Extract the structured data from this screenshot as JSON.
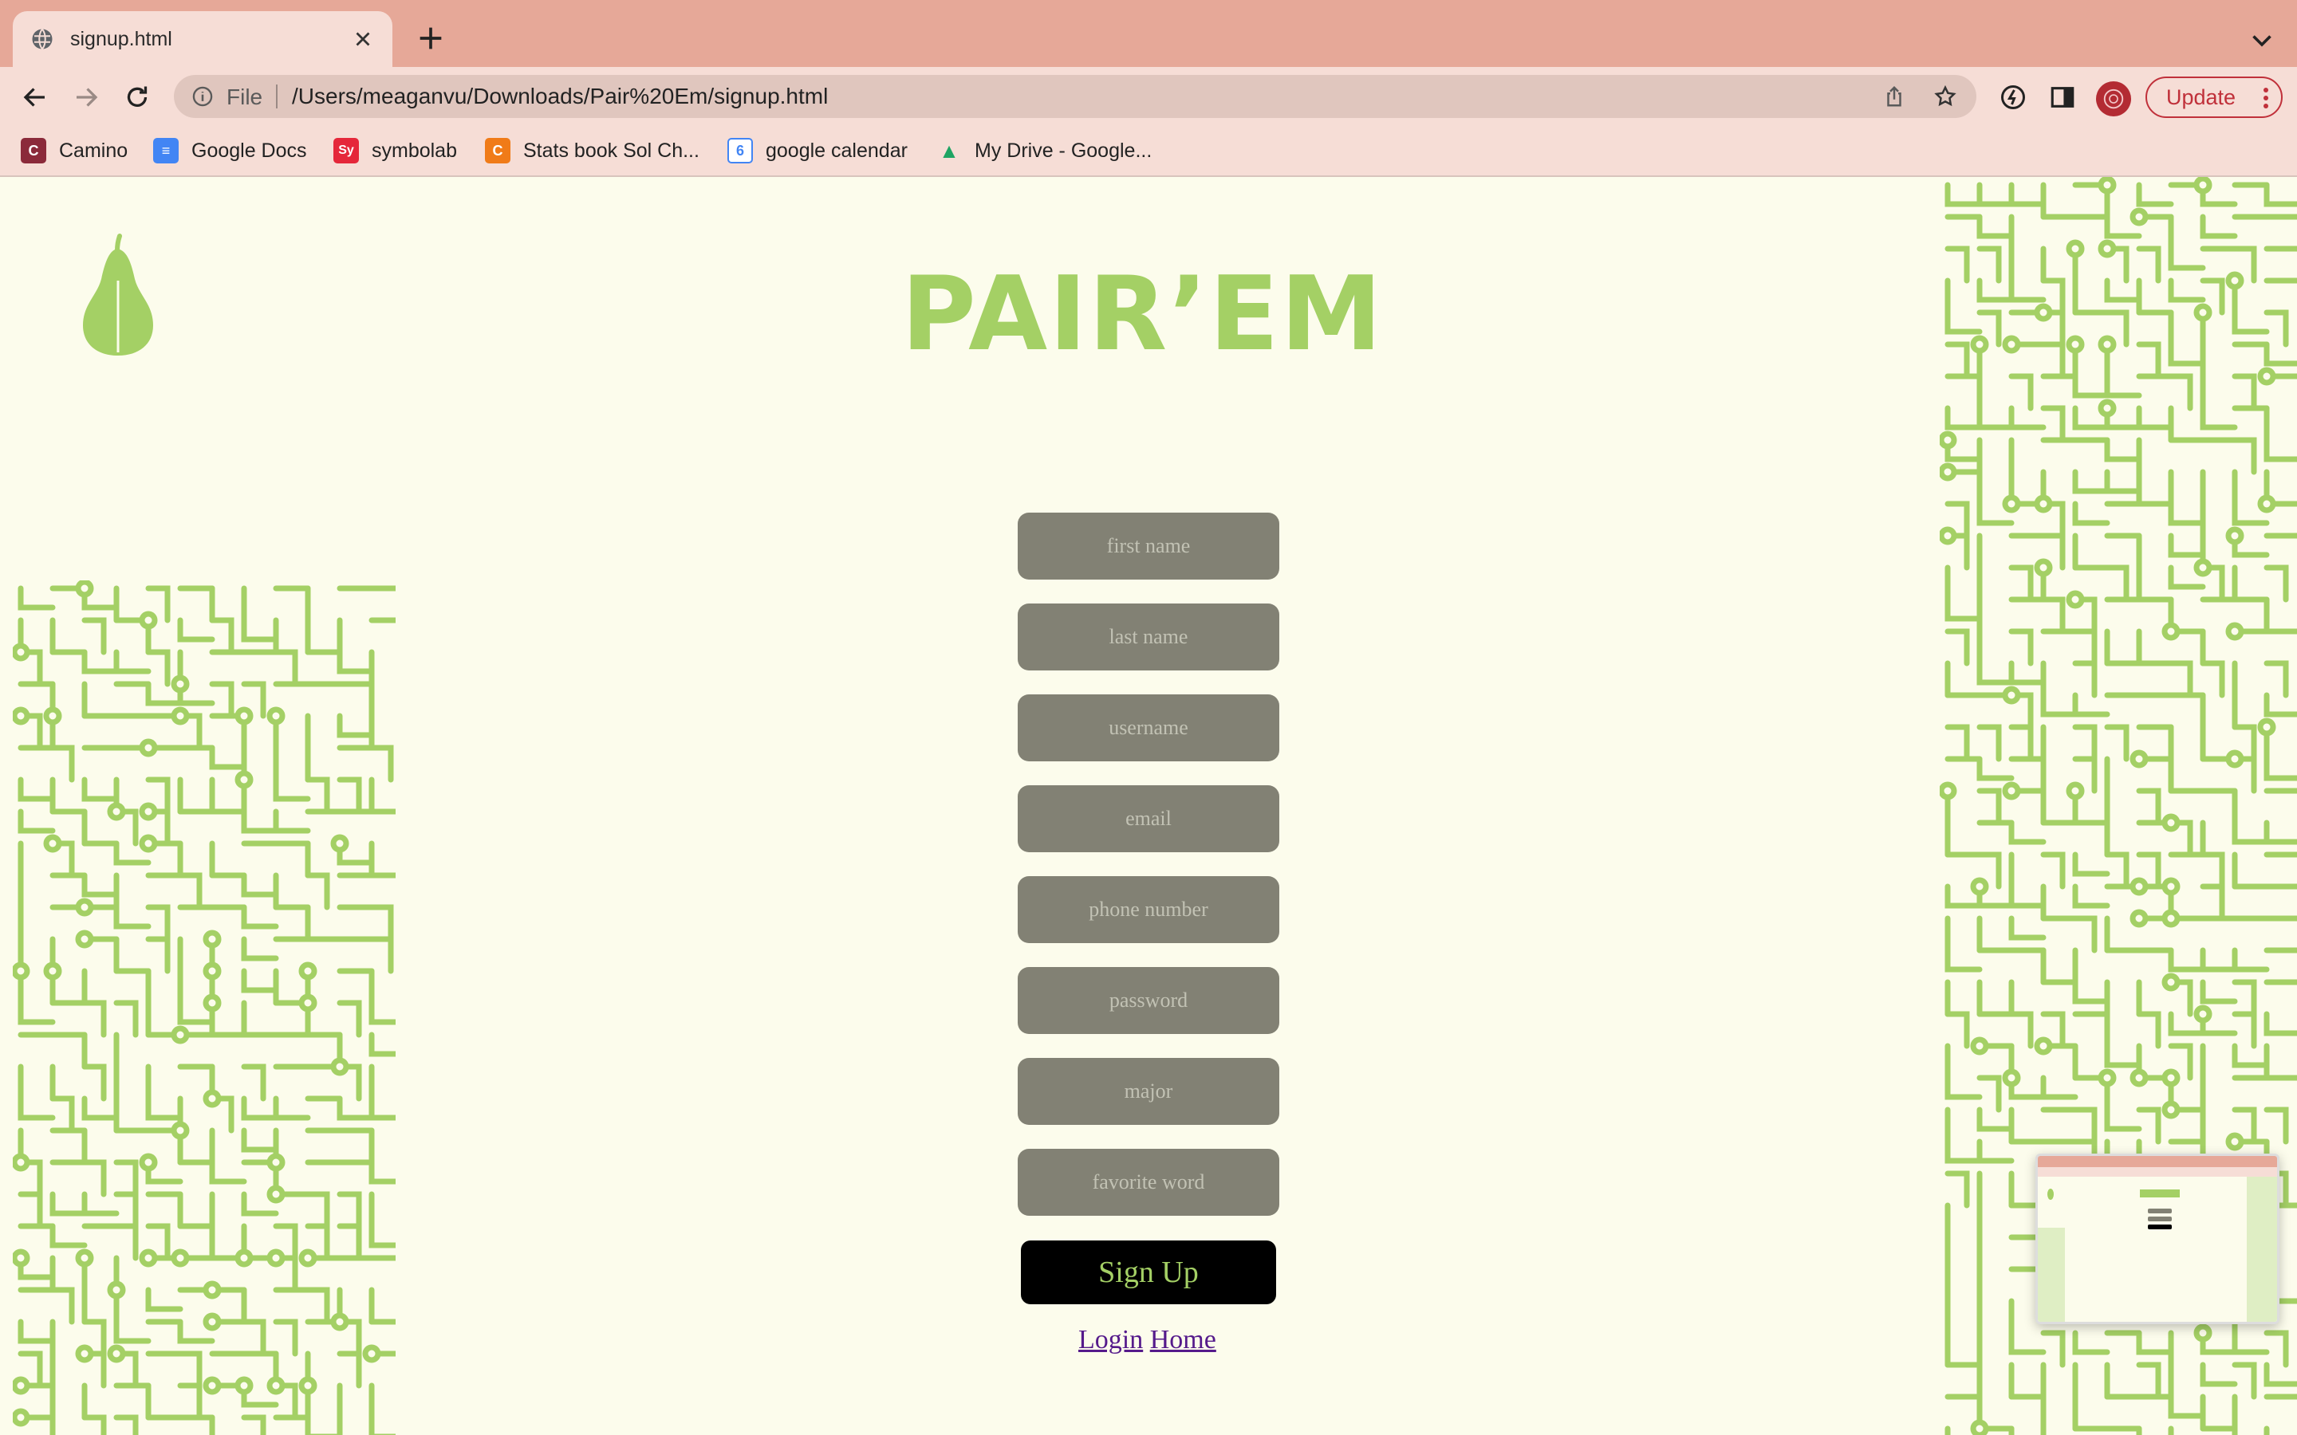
{
  "browser": {
    "tab": {
      "title": "signup.html",
      "icon": "globe-icon"
    },
    "new_tab_icon": "plus-icon",
    "url_scheme": "File",
    "url_path": "/Users/meaganvu/Downloads/Pair%20Em/signup.html",
    "update_label": "Update",
    "bookmarks": [
      {
        "label": "Camino",
        "icon": "C",
        "color": "#8b2a3a"
      },
      {
        "label": "Google Docs",
        "icon": "≡",
        "color": "#4285f4"
      },
      {
        "label": "symbolab",
        "icon": "Sy",
        "color": "#e5273a"
      },
      {
        "label": "Stats book Sol Ch...",
        "icon": "C",
        "color": "#f07b18"
      },
      {
        "label": "google calendar",
        "icon": "6",
        "color": "#4285f4"
      },
      {
        "label": "My Drive - Google...",
        "icon": "▲",
        "color": "#1fa463"
      }
    ]
  },
  "page": {
    "brand": "PAIR’EM",
    "accent_color": "#a4d065",
    "fields": [
      {
        "name": "first-name-field",
        "placeholder": "first name"
      },
      {
        "name": "last-name-field",
        "placeholder": "last name"
      },
      {
        "name": "username-field",
        "placeholder": "username"
      },
      {
        "name": "email-field",
        "placeholder": "email"
      },
      {
        "name": "phone-number-field",
        "placeholder": "phone number"
      },
      {
        "name": "password-field",
        "placeholder": "password"
      },
      {
        "name": "major-field",
        "placeholder": "major"
      },
      {
        "name": "favorite-word-field",
        "placeholder": "favorite word"
      }
    ],
    "signup_label": "Sign Up",
    "login_link": "Login",
    "home_link": "Home"
  }
}
